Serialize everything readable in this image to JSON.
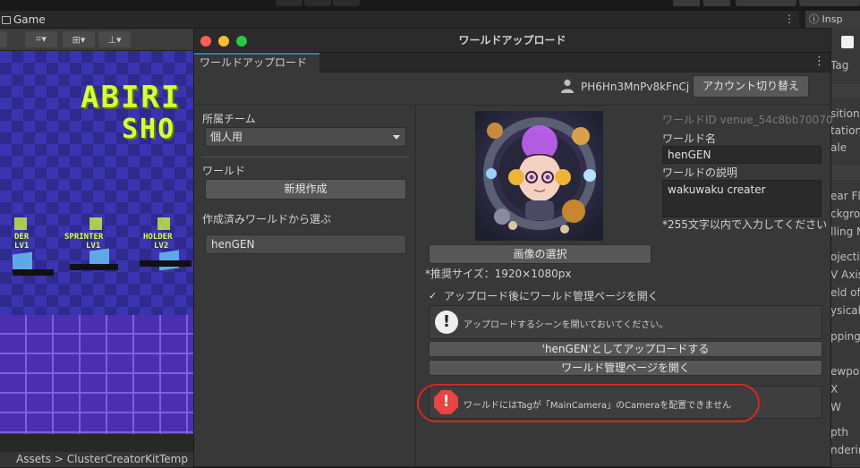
{
  "editor": {
    "game_tab": "Game",
    "inspector_tab": "Insp",
    "breadcrumb": "Assets > ClusterCreatorKitTemp",
    "inspector_rows": [
      "Tag",
      "sition",
      "tation",
      "ale",
      "ear Fla",
      "ckgro",
      "lling M",
      "ojectio",
      "V Axis",
      "eld of V",
      "ysical",
      "pping",
      "ewpor",
      "X",
      "W",
      "pth",
      "ndering"
    ]
  },
  "scene": {
    "sign_title_1": "ABIRI",
    "sign_title_2": "SHO",
    "signs": [
      "DER",
      "SPRINTER",
      "HOLDER",
      "LV1",
      "LV1",
      "LV2"
    ]
  },
  "window": {
    "title": "ワールドアップロード",
    "tab_label": "ワールドアップロード",
    "user_id": "PH6Hn3MnPv8kFnCj",
    "switch_account_label": "アカウント切り替え",
    "team_label": "所属チーム",
    "team_value": "個人用",
    "world_label": "ワールド",
    "new_button_label": "新規作成",
    "choose_label": "作成済みワールドから選ぶ",
    "existing_world": "henGEN",
    "world_id_label": "ワールドID venue_54c8bb70070",
    "world_name_label": "ワールド名",
    "world_name_value": "henGEN",
    "world_desc_label": "ワールドの説明",
    "world_desc_value": "wakuwaku creater",
    "char_limit_note": "*255文字以内で入力してください",
    "pick_image_label": "画像の選択",
    "recommended_size": "*推奨サイズ：1920×1080px",
    "open_after_upload_label": "アップロード後にワールド管理ページを開く",
    "open_after_upload_checked": true,
    "info_message": "アップロードするシーンを開いておいてください。",
    "upload_button_label": "'henGEN'としてアップロードする",
    "manage_button_label": "ワールド管理ページを開く",
    "error_message": "ワールドにはTagが「MainCamera」のCameraを配置できません"
  },
  "colors": {
    "accent_tab": "#3a79bb",
    "error_red": "#e84545",
    "highlight_ring": "#d8281f",
    "traffic_close": "#ff5f57",
    "traffic_min": "#febc2e",
    "traffic_max": "#28c840"
  }
}
